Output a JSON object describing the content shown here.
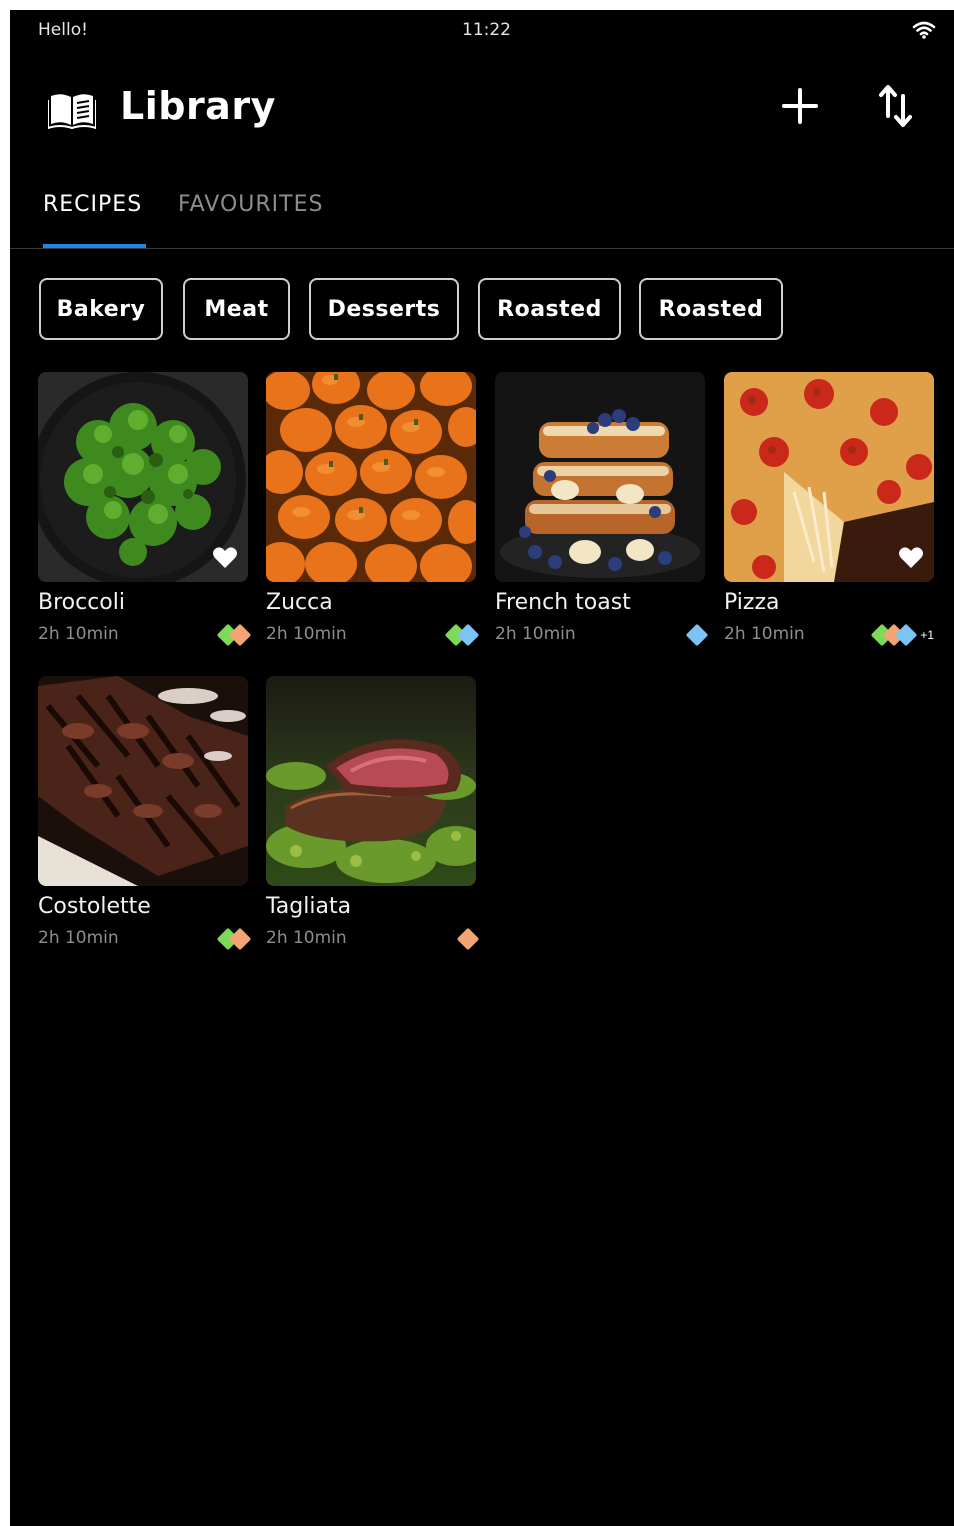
{
  "status": {
    "left_text": "Hello!",
    "time": "11:22",
    "wifi_icon": "wifi-icon"
  },
  "appbar": {
    "title": "Library",
    "icon": "book-icon",
    "actions": [
      "add-icon",
      "sort-icon"
    ]
  },
  "tabs": [
    {
      "label": "RECIPES",
      "active": true
    },
    {
      "label": "FAVOURITES",
      "active": false
    }
  ],
  "chips": [
    "Bakery",
    "Meat",
    "Desserts",
    "Roasted",
    "Roasted"
  ],
  "colors": {
    "accent": "#1e88e5",
    "tag_green": "#7ed957",
    "tag_orange": "#f4a574",
    "tag_blue": "#7cc4f5"
  },
  "recipes": [
    {
      "name": "Broccoli",
      "time": "2h 10min",
      "favourite": true,
      "tags": [
        "green",
        "orange"
      ],
      "more": ""
    },
    {
      "name": "Zucca",
      "time": "2h 10min",
      "favourite": false,
      "tags": [
        "green",
        "blue"
      ],
      "more": ""
    },
    {
      "name": "French toast",
      "time": "2h 10min",
      "favourite": false,
      "tags": [
        "blue"
      ],
      "more": ""
    },
    {
      "name": "Pizza",
      "time": "2h 10min",
      "favourite": true,
      "tags": [
        "green",
        "orange",
        "blue"
      ],
      "more": "+1"
    },
    {
      "name": "Costolette",
      "time": "2h 10min",
      "favourite": false,
      "tags": [
        "green",
        "orange"
      ],
      "more": ""
    },
    {
      "name": "Tagliata",
      "time": "2h 10min",
      "favourite": false,
      "tags": [
        "orange"
      ],
      "more": ""
    }
  ]
}
